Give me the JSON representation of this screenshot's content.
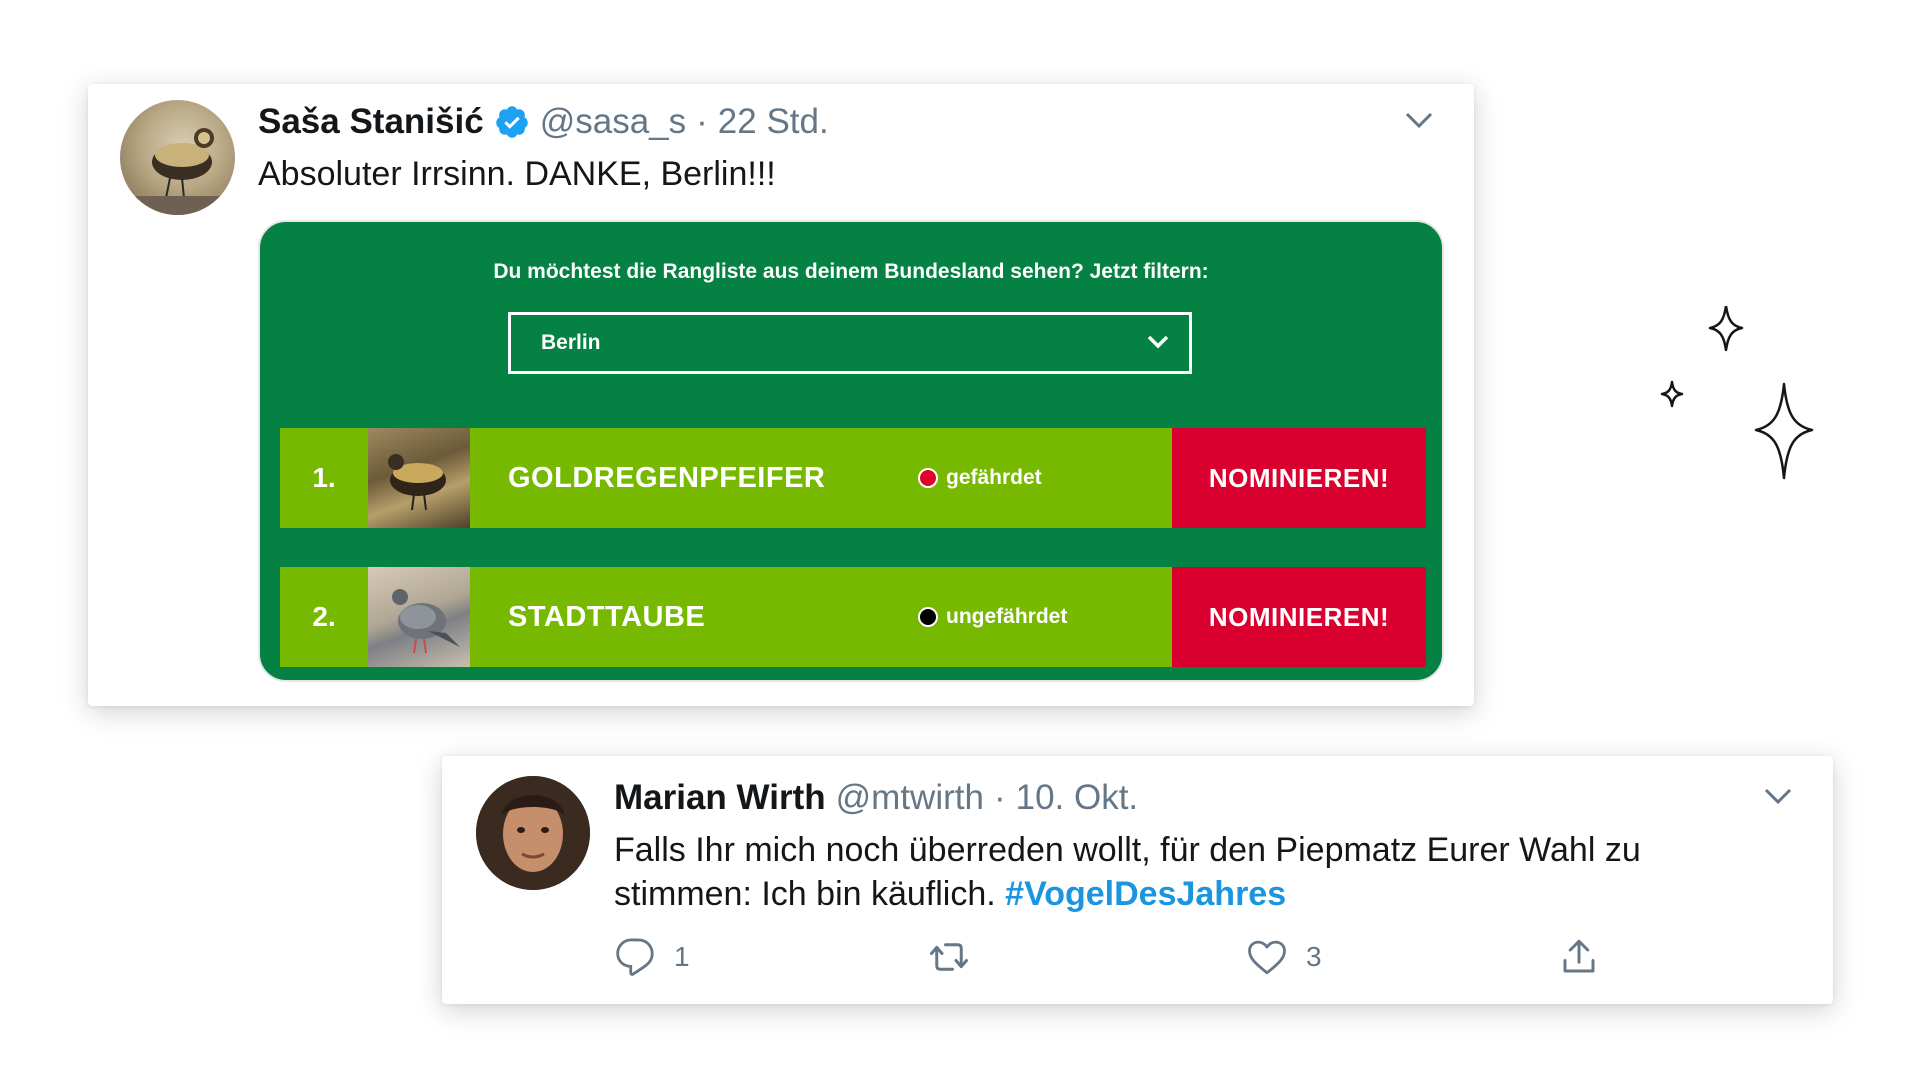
{
  "tweet1": {
    "name": "Saša Stanišić",
    "handle": "@sasa_s",
    "separator": "·",
    "time": "22 Std.",
    "text": "Absoluter Irrsinn. DANKE, Berlin!!!",
    "widget": {
      "filter_label": "Du möchtest die Rangliste aus deinem Bundesland sehen? Jetzt filtern:",
      "selected_state": "Berlin",
      "rows": [
        {
          "rank": "1.",
          "bird": "GOLDREGENPFEIFER",
          "status": "gefährdet",
          "status_color": "#e0002a",
          "button": "NOMINIEREN!"
        },
        {
          "rank": "2.",
          "bird": "STADTTAUBE",
          "status": "ungefährdet",
          "status_color": "#000000",
          "button": "NOMINIEREN!"
        }
      ]
    }
  },
  "tweet2": {
    "name": "Marian Wirth",
    "handle": "@mtwirth",
    "separator": "·",
    "time": "10. Okt.",
    "text": "Falls Ihr mich noch überreden wollt, für den Piepmatz Eurer Wahl zu stimmen: Ich bin käuflich. ",
    "hashtag": "#VogelDesJahres",
    "reply_count": "1",
    "like_count": "3"
  },
  "colors": {
    "widget_green": "#058243",
    "row_green": "#76b900",
    "button_red": "#d9002f",
    "link_blue": "#1b95e0",
    "muted_gray": "#657786"
  },
  "icons": [
    "verified-badge-icon",
    "chevron-down-icon",
    "reply-icon",
    "retweet-icon",
    "like-icon",
    "share-icon",
    "sparkle-icon"
  ]
}
